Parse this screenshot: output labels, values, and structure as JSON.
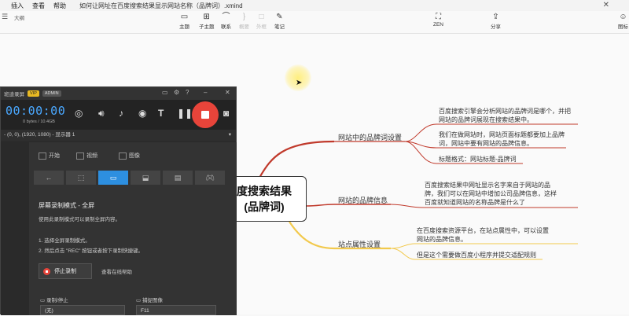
{
  "menu": {
    "items": [
      "插入",
      "查看",
      "帮助"
    ],
    "doc_title": "如何让网址在百度搜索结果显示网站名称（品牌词）.xmind"
  },
  "toolbar": {
    "left_label": "大纲",
    "topic": "主题",
    "subtopic": "子主题",
    "relation": "联系",
    "summary": "概要",
    "boundary": "外框",
    "note": "笔记",
    "zen": "ZEN",
    "share": "分享",
    "right_label": "图标"
  },
  "mindmap": {
    "central": [
      "度搜索结果",
      "(品牌词)"
    ],
    "branches": [
      {
        "label": "网站中的品牌词设置",
        "color": "#c0392b",
        "children": [
          [
            "百度搜索引擎会分析网站的品牌词是哪个，并把",
            "网站的品牌词展现在搜索结果中。"
          ],
          [
            "我们在做网站时，网站页面标题都要加上品牌",
            "词，网站中要有网站的品牌信息。"
          ],
          [
            "标题格式：网站标题-品牌词"
          ]
        ]
      },
      {
        "label": "网站的品牌信息",
        "color": "#c0392b",
        "children": [
          [
            "百度搜索结果中网址显示名字来自于网站的品",
            "牌，我们可以在网站中增加公司品牌信息，这样",
            "百度就知道网站的名称品牌是什么了"
          ]
        ]
      },
      {
        "label": "站点属性设置",
        "color": "#f2c94c",
        "children": [
          [
            "在百度搜索资源平台，在站点属性中，可以设置",
            "网站的品牌信息。"
          ],
          [
            "但是这个需要做百度小程序并提交适配规则"
          ]
        ]
      }
    ]
  },
  "recorder": {
    "app_name": "班迪录屏",
    "vip": "VIP",
    "admin": "ADMIN",
    "timer": "00:00:00",
    "size": "0 bytes / 10.4GB",
    "region": "- (0, 0), (1920, 1080) - 显示器 1",
    "tabs": [
      "开始",
      "视频",
      "图像"
    ],
    "mode_title": "屏幕录制模式 - 全屏",
    "mode_desc": "使用此录制模式可以录制全屏内容。",
    "steps": [
      "1. 选择全屏录制模式。",
      "2. 然后点击 \"REC\" 按钮或者按下录制快捷键。"
    ],
    "stop_label": "停止录制",
    "help_label": "查看在线帮助",
    "hotkey_label": "录制/停止",
    "capture_label": "捕捉图像",
    "hotkey_value": "(无)",
    "capture_value": "F11"
  }
}
